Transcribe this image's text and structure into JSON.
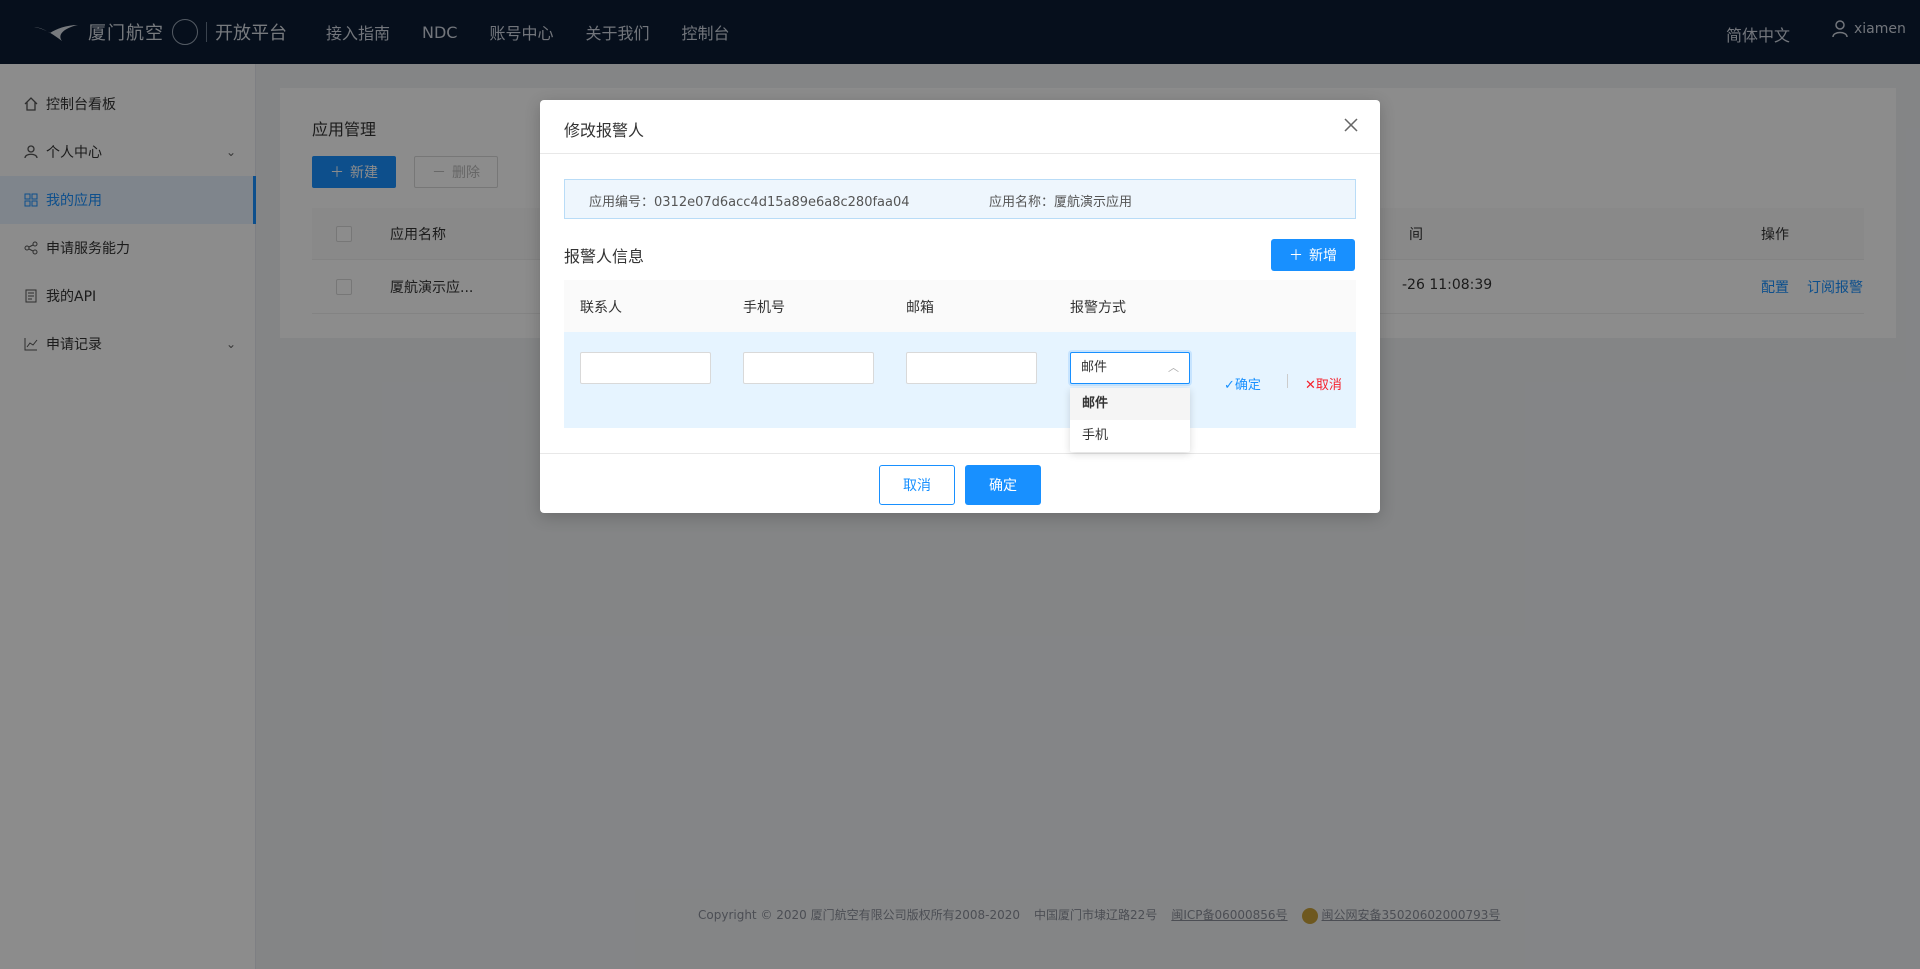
{
  "topbar": {
    "logo_text": "厦门航空",
    "platform_text": "开放平台",
    "nav": [
      "接入指南",
      "NDC",
      "账号中心",
      "关于我们",
      "控制台"
    ],
    "language": "简体中文",
    "username": "xiamen"
  },
  "sidebar": {
    "items": [
      {
        "label": "控制台看板",
        "icon": "home-icon"
      },
      {
        "label": "个人中心",
        "icon": "user-icon"
      },
      {
        "label": "我的应用",
        "icon": "apps-icon"
      },
      {
        "label": "申请服务能力",
        "icon": "share-icon"
      },
      {
        "label": "我的API",
        "icon": "document-icon"
      },
      {
        "label": "申请记录",
        "icon": "chart-icon"
      }
    ],
    "active_index": 2
  },
  "main": {
    "title": "应用管理",
    "new_label": "新建",
    "delete_label": "删除",
    "columns": {
      "name": "应用名称",
      "time_partial": "间",
      "actions": "操作"
    },
    "row": {
      "name": "厦航演示应...",
      "time": "-26 11:08:39",
      "config": "配置",
      "subscribe": "订阅报警"
    }
  },
  "footer": {
    "copyright": "Copyright © 2020 厦门航空有限公司版权所有2008-2020",
    "address": "中国厦门市埭辽路22号",
    "icp": "闽ICP备06000856号",
    "police": "闽公网安备35020602000793号"
  },
  "modal": {
    "title": "修改报警人",
    "app_id_label": "应用编号：",
    "app_id": "0312e07d6acc4d15a89e6a8c280faa04",
    "app_name_label": "应用名称：",
    "app_name": "厦航演示应用",
    "section_title": "报警人信息",
    "add_label": "新增",
    "columns": [
      "联系人",
      "手机号",
      "邮箱",
      "报警方式"
    ],
    "select_value": "邮件",
    "options": [
      "邮件",
      "手机"
    ],
    "row_confirm": "确定",
    "row_cancel": "取消",
    "cancel_label": "取消",
    "ok_label": "确定"
  },
  "colors": {
    "primary": "#1890ff",
    "topbar_bg": "#0b1c33",
    "danger": "#f5222d"
  }
}
